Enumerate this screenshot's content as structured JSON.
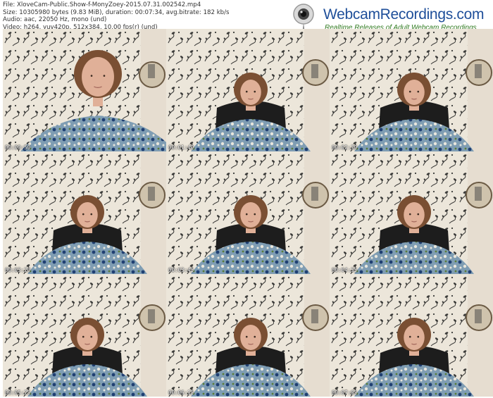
{
  "file_info": {
    "file": "File: XloveCam-Public.Show-f-MonyZoey-2015.07.31.002542.mp4",
    "size": "Size: 10305980 bytes (9.83 MiB), duration: 00:07:34, avg.bitrate: 182 kb/s",
    "audio": "Audio: aac, 22050 Hz, mono (und)",
    "video": "Video: h264, yuv420p, 512x384, 10.00 fps(r) (und)"
  },
  "logo": {
    "brand": "WebcamRecordings.com",
    "tagline": "Realtime Releases of Adult Webcam Recordings"
  },
  "thumbnails": [
    {
      "timestamp": "00:00:50"
    },
    {
      "timestamp": "00:01:40"
    },
    {
      "timestamp": "00:02:30"
    },
    {
      "timestamp": "00:03:20"
    },
    {
      "timestamp": "00:03:45"
    },
    {
      "timestamp": "00:04:35"
    },
    {
      "timestamp": "00:05:25"
    },
    {
      "timestamp": "00:06:15"
    },
    {
      "timestamp": "00:07:05"
    }
  ],
  "colors": {
    "wall": "#e9e2d6",
    "pattern": "#3a3a38",
    "shirt": "#6f8fa8",
    "hair": "#7a4f33",
    "skin": "#e0b098",
    "chair": "#1d1d1d",
    "brand_blue": "#1f4f9a",
    "tag_green": "#2f7a1f"
  }
}
